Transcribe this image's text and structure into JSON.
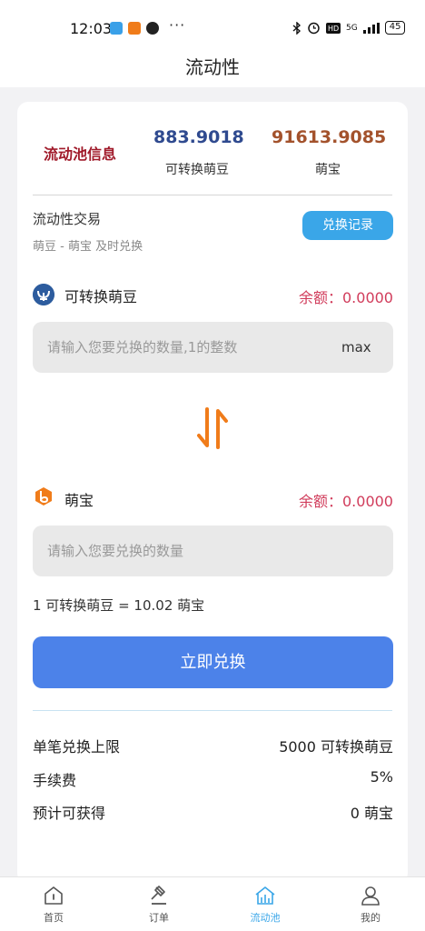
{
  "status_bar": {
    "time": "12:03",
    "more": "···",
    "network": "5G",
    "battery": "45"
  },
  "header": {
    "title": "流动性"
  },
  "pool_info": {
    "label": "流动池信息",
    "stat1": {
      "value": "883.9018",
      "label": "可转换萌豆"
    },
    "stat2": {
      "value": "91613.9085",
      "label": "萌宝"
    }
  },
  "trade": {
    "title": "流动性交易",
    "subtitle": "萌豆 - 萌宝 及时兑换",
    "history_button": "兑换记录"
  },
  "token_from": {
    "name": "可转换萌豆",
    "balance": "余额：0.0000",
    "placeholder": "请输入您要兑换的数量,1的整数",
    "max_label": "max"
  },
  "token_to": {
    "name": "萌宝",
    "balance": "余额：0.0000",
    "placeholder": "请输入您要兑换的数量"
  },
  "rate": "1 可转换萌豆 = 10.02 萌宝",
  "exchange_button": "立即兑换",
  "info": [
    {
      "label": "单笔兑换上限",
      "value": "5000 可转换萌豆"
    },
    {
      "label": "手续费",
      "value": "5%"
    },
    {
      "label": "预计可获得",
      "value": "0 萌宝"
    }
  ],
  "tabs": [
    {
      "label": "首页",
      "icon": "home-icon"
    },
    {
      "label": "订单",
      "icon": "gavel-icon"
    },
    {
      "label": "流动池",
      "icon": "pool-icon",
      "active": true
    },
    {
      "label": "我的",
      "icon": "user-icon"
    }
  ],
  "colors": {
    "primary_button": "#4c82e9",
    "history_button": "#3aa6e8",
    "balance": "#d13c5b",
    "pool_label": "#a01a2a",
    "stat1_value": "#2f4a8f",
    "stat2_value": "#a3522c",
    "swap_arrows": "#f07c1a"
  }
}
